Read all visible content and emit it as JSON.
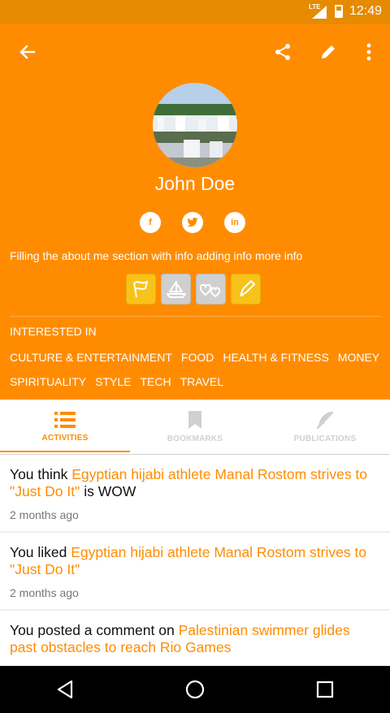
{
  "status_bar": {
    "network": "LTE",
    "time": "12:49"
  },
  "colors": {
    "accent": "#ff8c00",
    "status_bar": "#e68a00"
  },
  "toolbar": {
    "icons": [
      "arrow-back-icon",
      "share-icon",
      "edit-icon",
      "more-vert-icon"
    ]
  },
  "profile": {
    "name": "John Doe",
    "social": [
      {
        "icon": "facebook-icon",
        "glyph": "f"
      },
      {
        "icon": "twitter-icon",
        "glyph": "t"
      },
      {
        "icon": "linkedin-icon",
        "glyph": "in"
      }
    ],
    "about": "Filling the about me section with info adding info more info",
    "badges": [
      "flag-badge",
      "boat-badge",
      "hearts-badge",
      "pen-badge"
    ]
  },
  "interests": {
    "title": "INTERESTED IN",
    "items": [
      "CULTURE & ENTERTAINMENT",
      "FOOD",
      "HEALTH & FITNESS",
      "MONEY",
      "SPIRITUALITY",
      "STYLE",
      "TECH",
      "TRAVEL"
    ]
  },
  "tabs": [
    {
      "label": "ACTIVITIES",
      "icon": "list-icon",
      "active": true
    },
    {
      "label": "BOOKMARKS",
      "icon": "bookmark-icon",
      "active": false
    },
    {
      "label": "PUBLICATIONS",
      "icon": "quill-icon",
      "active": false
    }
  ],
  "feed": [
    {
      "prefix": "You think ",
      "link": "Egyptian hijabi athlete Manal Rostom strives to \"Just Do It\"",
      "suffix": " is WOW",
      "time": "2 months ago"
    },
    {
      "prefix": "You liked ",
      "link": "Egyptian hijabi athlete Manal Rostom strives to \"Just Do It\"",
      "suffix": "",
      "time": "2 months ago"
    },
    {
      "prefix": "You posted a comment on ",
      "link": "Palestinian swimmer glides past obstacles to reach Rio Games",
      "suffix": "",
      "time": ""
    }
  ],
  "navbar": {
    "icons": [
      "back-nav-icon",
      "home-nav-icon",
      "recents-nav-icon"
    ]
  }
}
